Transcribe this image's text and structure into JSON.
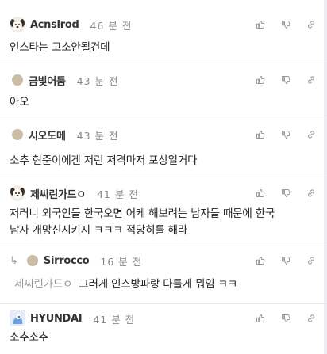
{
  "comments": [
    {
      "nick": "Acnslrod",
      "time": "46 분 전",
      "text": "인스타는 고소안될건데",
      "avatar": "dog-avatar-icon"
    },
    {
      "nick": "금빛어둠",
      "time": "43 분 전",
      "text": "아오",
      "avatar": "dot-avatar-icon"
    },
    {
      "nick": "시오도메",
      "time": "43 분 전",
      "text": "소추 현준이에겐 저런 저격마저 포상일거다",
      "avatar": "dot-avatar-icon"
    },
    {
      "nick": "제씨린가드ㅇ",
      "time": "41 분 전",
      "text_line1": "저러니 외국인들 한국오면 어케 해보려는 남자들 때문에 한국",
      "text_line2": "남자 개망신시키지 ㅋㅋㅋ 적당히를 해라",
      "avatar": "dog-avatar-icon"
    },
    {
      "nick": "Sirrocco",
      "time": "16 분 전",
      "mention": "제씨린가드ㅇ",
      "text": "그러게 인스방파랑 다를게 뭐임 ㅋㅋ",
      "avatar": "dot-avatar-icon",
      "is_reply": true
    },
    {
      "nick": "HYUNDAI",
      "time": "41 분 전",
      "text": "소추소추",
      "avatar": "hyundai-avatar-icon"
    }
  ],
  "colors": {
    "divider": "#e6e6e6",
    "muted": "#888888",
    "icon": "#9a9a9a"
  },
  "icons": [
    "thumbs-up-icon",
    "thumbs-down-icon",
    "link-icon"
  ]
}
